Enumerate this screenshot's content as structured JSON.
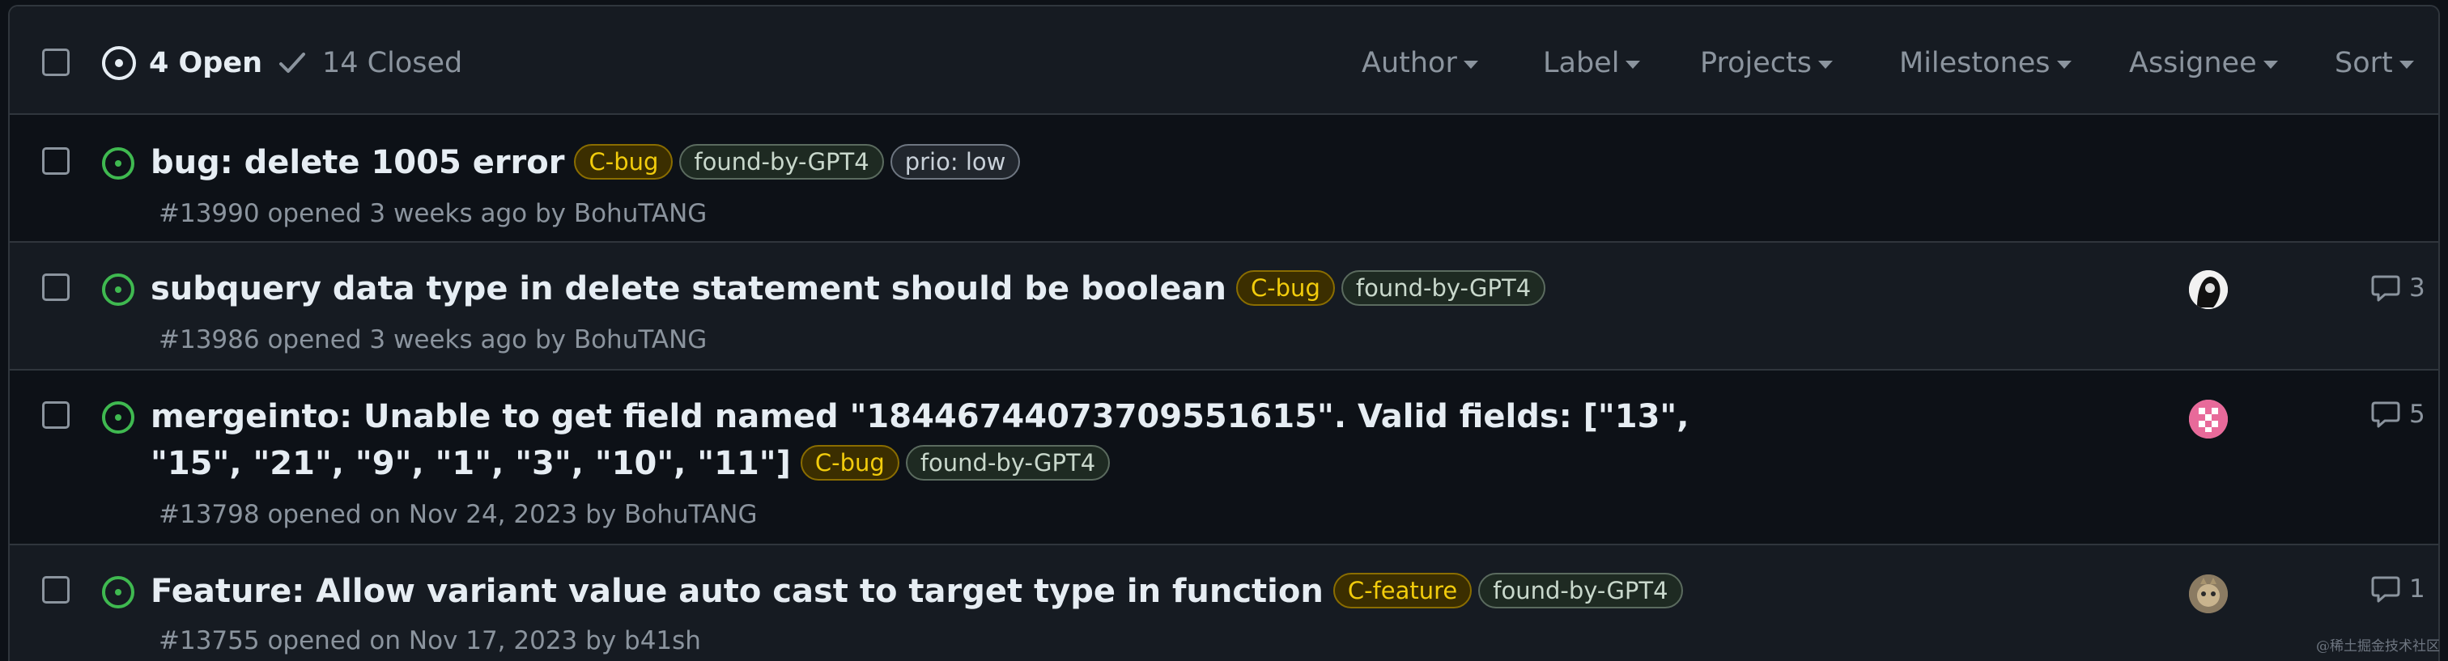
{
  "header": {
    "open_count_label": "4 Open",
    "closed_count_label": "14 Closed",
    "filters": [
      {
        "label": "Author"
      },
      {
        "label": "Label"
      },
      {
        "label": "Projects"
      },
      {
        "label": "Milestones"
      },
      {
        "label": "Assignee"
      },
      {
        "label": "Sort"
      }
    ]
  },
  "issues": [
    {
      "title": "bug: delete 1005 error",
      "labels": [
        "C-bug",
        "found-by-GPT4",
        "prio: low"
      ],
      "meta": "#13990 opened 3 weeks ago by BohuTANG",
      "comments": null,
      "has_assignee": false
    },
    {
      "title": "subquery data type in delete statement should be boolean",
      "labels": [
        "C-bug",
        "found-by-GPT4"
      ],
      "meta": "#13986 opened 3 weeks ago by BohuTANG",
      "comments": "3",
      "has_assignee": true
    },
    {
      "title": "mergeinto: Unable to get field named \"18446744073709551615\". Valid fields: [\"13\", \"15\", \"21\", \"9\", \"1\", \"3\", \"10\", \"11\"]",
      "labels": [
        "C-bug",
        "found-by-GPT4"
      ],
      "meta": "#13798 opened on Nov 24, 2023 by BohuTANG",
      "comments": "5",
      "has_assignee": true
    },
    {
      "title": "Feature: Allow variant value auto cast to target type in function",
      "labels": [
        "C-feature",
        "found-by-GPT4"
      ],
      "meta": "#13755 opened on Nov 17, 2023 by b41sh",
      "comments": "1",
      "has_assignee": true
    }
  ],
  "watermark": "@稀土掘金技术社区",
  "colors": {
    "background": "#0d1117",
    "header_bg": "#161b22",
    "border": "#30363d",
    "open_green": "#3fb950",
    "label_bug_text": "#f2cc0c",
    "muted_text": "#8b949e"
  },
  "icons": {
    "open_state": "issue-opened-icon",
    "closed_state": "check-icon",
    "comment": "comment-icon",
    "caret": "triangle-down-icon"
  }
}
